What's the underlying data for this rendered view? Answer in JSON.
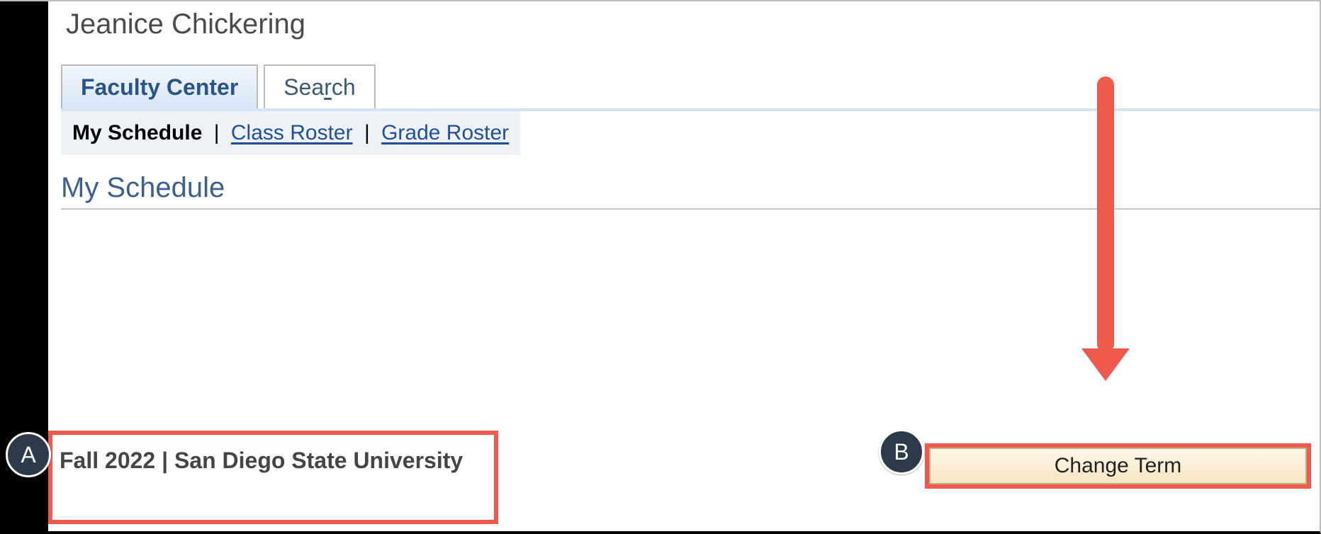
{
  "user_name": "Jeanice Chickering",
  "tabs": {
    "faculty_center": "Faculty Center",
    "search_pre": "Sea",
    "search_u": "r",
    "search_post": "ch"
  },
  "subnav": {
    "my_schedule": "My Schedule",
    "class_roster_u": "C",
    "class_roster_rest": "lass Roster",
    "grade_roster_u": "G",
    "grade_roster_rest": "rade Roster"
  },
  "section_title": "My Schedule",
  "term_label": "Fall 2022 | San Diego State University",
  "change_term_label": "Change Term",
  "badge_a": "A",
  "badge_b": "B",
  "separator": "   |   "
}
